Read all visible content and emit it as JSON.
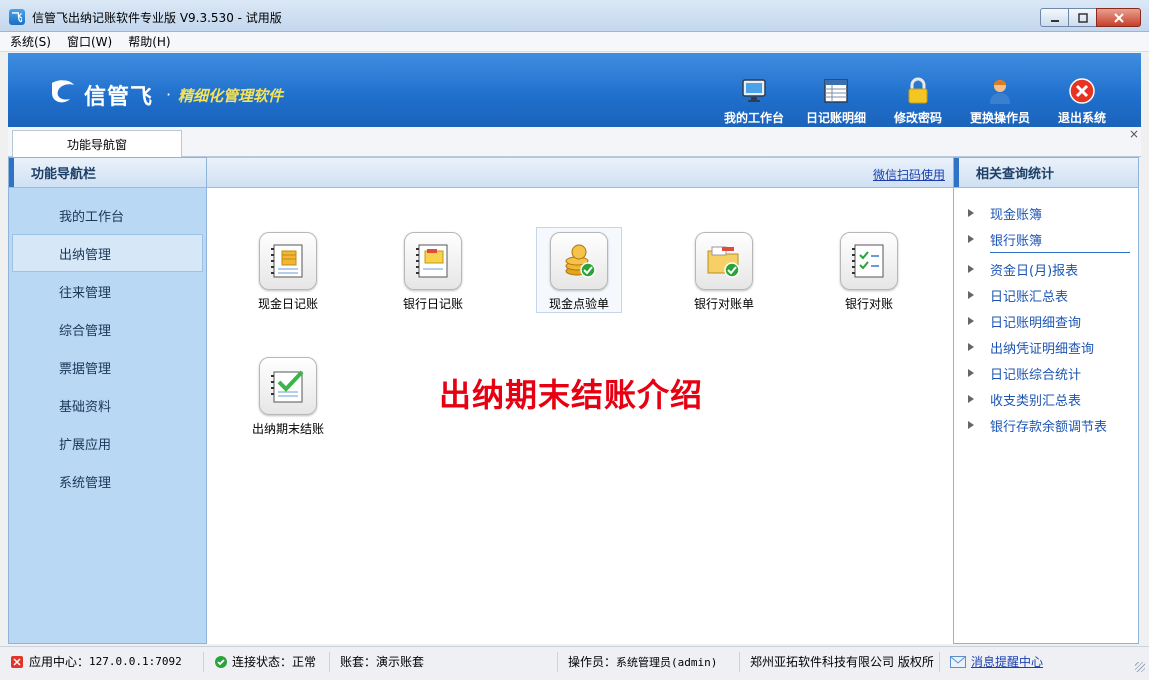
{
  "window": {
    "title": "信管飞出纳记账软件专业版 V9.3.530 - 试用版",
    "app_icon_glyph": "飞"
  },
  "menu": [
    "系统(S)",
    "窗口(W)",
    "帮助(H)"
  ],
  "brand": {
    "name": "信管飞",
    "separator": "·",
    "slogan": "精细化管理软件"
  },
  "toolbar": [
    {
      "label": "我的工作台",
      "icon": "monitor-icon"
    },
    {
      "label": "日记账明细",
      "icon": "ledger-grid-icon"
    },
    {
      "label": "修改密码",
      "icon": "lock-icon"
    },
    {
      "label": "更换操作员",
      "icon": "user-icon"
    },
    {
      "label": "退出系统",
      "icon": "exit-icon"
    }
  ],
  "tabs": [
    {
      "label": "功能导航窗"
    }
  ],
  "tab_close": "×",
  "left_nav": {
    "title": "功能导航栏",
    "items": [
      "我的工作台",
      "出纳管理",
      "往来管理",
      "综合管理",
      "票据管理",
      "基础资料",
      "扩展应用",
      "系统管理"
    ],
    "active_index": 1
  },
  "center": {
    "wechat_link": "微信扫码使用",
    "functions": [
      {
        "label": "现金日记账",
        "icon": "cash-journal-icon"
      },
      {
        "label": "银行日记账",
        "icon": "bank-journal-icon"
      },
      {
        "label": "现金点验单",
        "icon": "coin-check-icon"
      },
      {
        "label": "银行对账单",
        "icon": "folder-check-icon"
      },
      {
        "label": "银行对账",
        "icon": "reconcile-icon"
      },
      {
        "label": "出纳期末结账",
        "icon": "period-close-icon"
      }
    ],
    "overlay_caption": "出纳期末结账介绍"
  },
  "right_panel": {
    "title": "相关查询统计",
    "items": [
      "现金账簿",
      "银行账簿",
      "资金日(月)报表",
      "日记账汇总表",
      "日记账明细查询",
      "出纳凭证明细查询",
      "日记账综合统计",
      "收支类别汇总表",
      "银行存款余额调节表"
    ]
  },
  "status": {
    "app_center_label": "应用中心：",
    "app_center_value": "127.0.0.1:7092",
    "connection_label": "连接状态：",
    "connection_value": "正常",
    "account_label": "账套：",
    "account_value": "演示账套",
    "operator_label": "操作员：",
    "operator_value": "系统管理员(admin)",
    "copyright": "郑州亚拓软件科技有限公司 版权所",
    "message_center": "消息提醒中心"
  },
  "colors": {
    "banner": "#1f6fcc",
    "slogan": "#f4e35a",
    "overlay_text": "#e60012",
    "link": "#1d55b3"
  }
}
